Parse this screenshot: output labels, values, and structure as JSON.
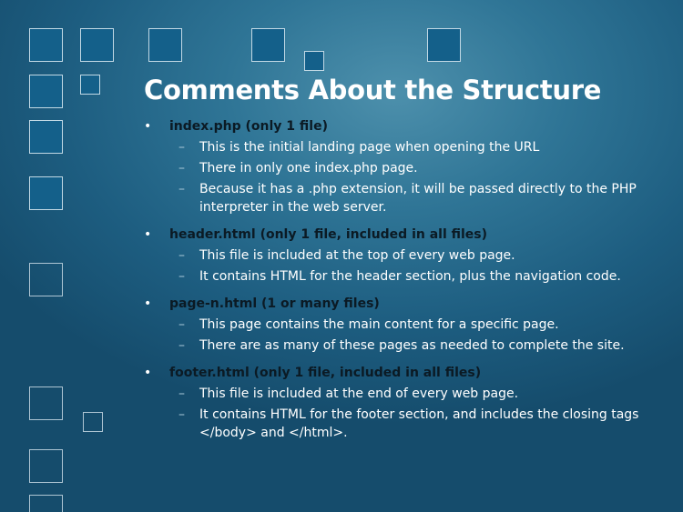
{
  "slide": {
    "title": "Comments About the Structure",
    "bullets": [
      {
        "text": "index.php (only 1 file)",
        "sub": [
          "This is the initial landing page when opening the URL",
          "There in only one index.php page.",
          "Because it has a .php extension, it will be passed directly to the PHP interpreter in the web server."
        ]
      },
      {
        "text": "header.html (only 1 file, included in all files)",
        "sub": [
          "This file is included at the top of every web page.",
          "It contains HTML for the header section, plus the navigation code."
        ]
      },
      {
        "text": "page-n.html (1 or many files)",
        "sub": [
          "This page contains the main content for a specific page.",
          "There are as many of these pages as needed to complete the site."
        ]
      },
      {
        "text": "footer.html (only 1 file, included in all files)",
        "sub": [
          "This file is included at the end of every web page.",
          "It contains HTML for the footer section, and includes the closing tags </body> and </html>."
        ]
      }
    ],
    "bullet_glyph": "•",
    "dash_glyph": "–"
  },
  "colors": {
    "background": "#2f7596",
    "title": "#ffffff",
    "level1_text": "#0b1a24",
    "level2_text": "#ffffff",
    "square_fill": "#14608a",
    "square_border": "#e1eef5"
  }
}
